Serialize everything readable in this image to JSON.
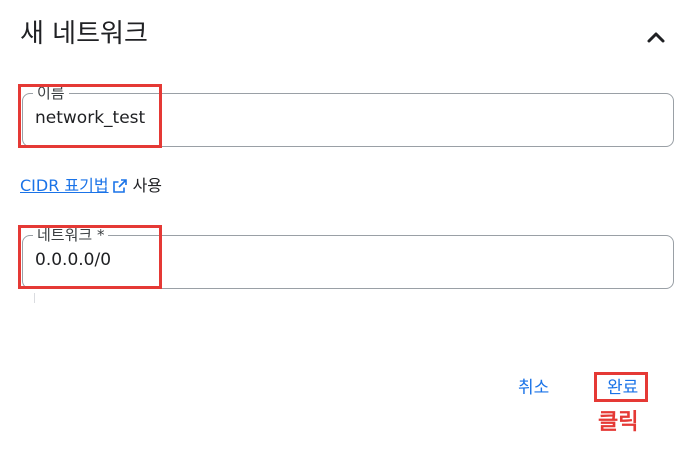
{
  "header": {
    "title": "새 네트워크",
    "collapse_icon": "chevron-up-icon"
  },
  "fields": {
    "name": {
      "label": "이름",
      "value": "network_test"
    },
    "network": {
      "label": "네트워크 *",
      "value": "0.0.0.0/0"
    }
  },
  "cidr": {
    "link_text": "CIDR 표기법",
    "suffix": "사용",
    "icon": "external-link-icon"
  },
  "actions": {
    "cancel_label": "취소",
    "done_label": "완료"
  },
  "annotation": {
    "click_label": "클릭",
    "highlight_color": "#e53935"
  },
  "colors": {
    "accent": "#1a73e8",
    "text": "#202124",
    "border": "#9aa0a6"
  }
}
